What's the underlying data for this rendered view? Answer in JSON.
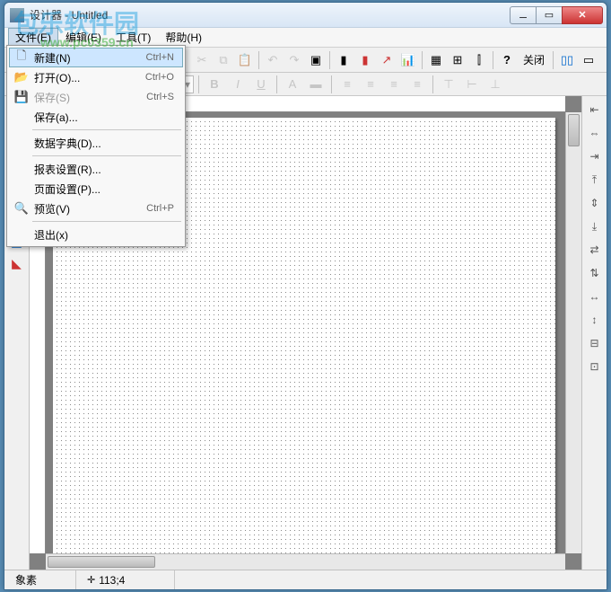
{
  "window": {
    "title": "设计器 - Untitled"
  },
  "watermark": {
    "text": "包乐软件园",
    "url": "www.pc0359.cn"
  },
  "menubar": {
    "file": "文件(E)",
    "edit": "编辑(E)",
    "tools": "工具(T)",
    "help": "帮助(H)"
  },
  "toolbar": {
    "close_label": "关闭"
  },
  "file_menu": {
    "new": "新建(N)",
    "new_accel": "Ctrl+N",
    "open": "打开(O)...",
    "open_accel": "Ctrl+O",
    "save": "保存(S)",
    "save_accel": "Ctrl+S",
    "save_as": "保存(a)...",
    "data_dict": "数据字典(D)...",
    "report_setup": "报表设置(R)...",
    "page_setup": "页面设置(P)...",
    "preview": "预览(V)",
    "preview_accel": "Ctrl+P",
    "exit": "退出(x)"
  },
  "status": {
    "mode": "象素",
    "coords": "113;4"
  }
}
